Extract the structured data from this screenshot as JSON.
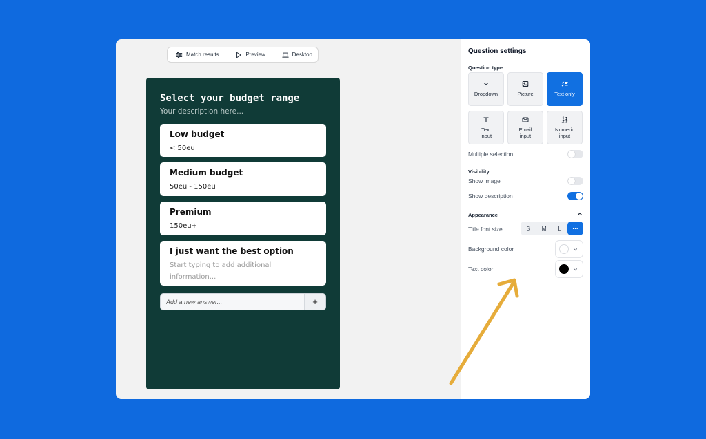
{
  "colors": {
    "background": "#0f6adf",
    "canvas": "#f2f2f2",
    "phone": "#103b37",
    "accent": "#1170e1",
    "arrow": "#e6ac3a"
  },
  "toolbar": {
    "match_results": {
      "label": "Match results",
      "icon": "sliders-icon"
    },
    "preview": {
      "label": "Preview",
      "icon": "play-icon"
    },
    "desktop": {
      "label": "Desktop",
      "icon": "laptop-icon"
    }
  },
  "question": {
    "title": "Select your budget range",
    "description": "Your description here...",
    "answers": [
      {
        "title": "Low budget",
        "description": "< 50eu"
      },
      {
        "title": "Medium budget",
        "description": "50eu - 150eu"
      },
      {
        "title": "Premium",
        "description": "150eu+"
      },
      {
        "title": "I just want the best option",
        "placeholder": "Start typing to add additional information..."
      }
    ],
    "add_answer": {
      "placeholder": "Add a new answer...",
      "button": "+"
    }
  },
  "settings": {
    "title": "Question settings",
    "question_type_label": "Question type",
    "types": [
      {
        "label": "Dropdown",
        "icon": "chevron-down-icon",
        "active": false
      },
      {
        "label": "Picture",
        "icon": "image-icon",
        "active": false
      },
      {
        "label": "Text only",
        "icon": "checklist-icon",
        "active": true
      },
      {
        "label": "Text\ninput",
        "icon": "text-icon",
        "active": false
      },
      {
        "label": "Email\ninput",
        "icon": "mail-icon",
        "active": false
      },
      {
        "label": "Numeric\ninput",
        "icon": "numeric-icon",
        "active": false
      }
    ],
    "multiple_selection": {
      "label": "Multiple selection",
      "on": false
    },
    "visibility_label": "Visibility",
    "show_image": {
      "label": "Show image",
      "on": false
    },
    "show_description": {
      "label": "Show description",
      "on": true
    },
    "appearance_label": "Appearance",
    "title_font_size": {
      "label": "Title font size",
      "options": [
        "S",
        "M",
        "L",
        "···"
      ],
      "selected": "···"
    },
    "background_color": {
      "label": "Background color",
      "value": "#ffffff"
    },
    "text_color": {
      "label": "Text color",
      "value": "#000000"
    }
  }
}
